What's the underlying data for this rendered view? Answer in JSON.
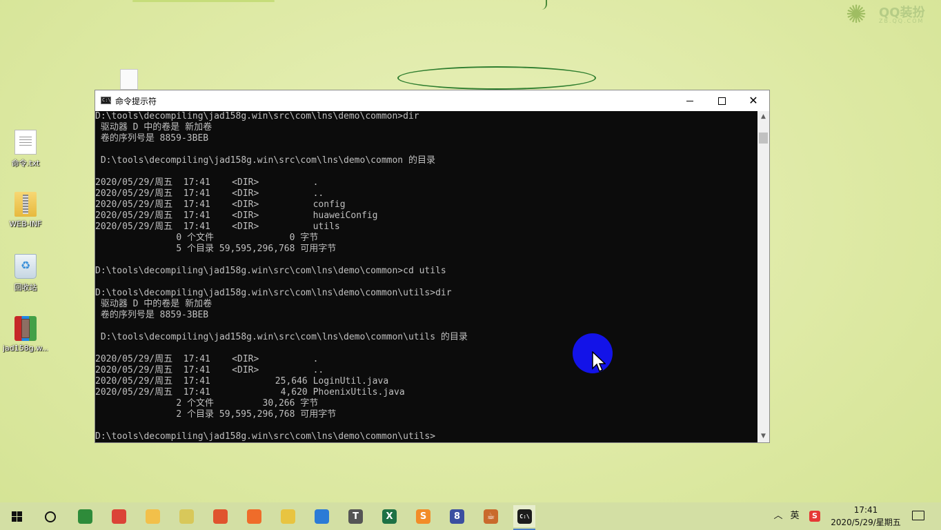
{
  "desktop": {
    "watermark": {
      "title": "QQ装扮",
      "subtitle": "ZB.QQ.COM"
    },
    "icons": [
      {
        "label": "命令.txt",
        "icon": "text-file-icon"
      },
      {
        "label": "WEB-INF",
        "icon": "folder-icon"
      },
      {
        "label": "回收站",
        "icon": "recycle-bin-icon"
      },
      {
        "label": "jad158g.w...",
        "icon": "winrar-archive-icon"
      }
    ]
  },
  "window": {
    "title": "命令提示符",
    "buttons": {
      "minimize": "minimize-icon",
      "maximize": "maximize-icon",
      "close": "✕"
    }
  },
  "console": {
    "lines": [
      "D:\\tools\\decompiling\\jad158g.win\\src\\com\\lns\\demo\\common>dir",
      " 驱动器 D 中的卷是 新加卷",
      " 卷的序列号是 8859-3BEB",
      "",
      " D:\\tools\\decompiling\\jad158g.win\\src\\com\\lns\\demo\\common 的目录",
      "",
      "2020/05/29/周五  17:41    <DIR>          .",
      "2020/05/29/周五  17:41    <DIR>          ..",
      "2020/05/29/周五  17:41    <DIR>          config",
      "2020/05/29/周五  17:41    <DIR>          huaweiConfig",
      "2020/05/29/周五  17:41    <DIR>          utils",
      "               0 个文件              0 字节",
      "               5 个目录 59,595,296,768 可用字节",
      "",
      "D:\\tools\\decompiling\\jad158g.win\\src\\com\\lns\\demo\\common>cd utils",
      "",
      "D:\\tools\\decompiling\\jad158g.win\\src\\com\\lns\\demo\\common\\utils>dir",
      " 驱动器 D 中的卷是 新加卷",
      " 卷的序列号是 8859-3BEB",
      "",
      " D:\\tools\\decompiling\\jad158g.win\\src\\com\\lns\\demo\\common\\utils 的目录",
      "",
      "2020/05/29/周五  17:41    <DIR>          .",
      "2020/05/29/周五  17:41    <DIR>          ..",
      "2020/05/29/周五  17:41            25,646 LoginUtil.java",
      "2020/05/29/周五  17:41             4,620 PhoenixUtils.java",
      "               2 个文件         30,266 字节",
      "               2 个目录 59,595,296,768 可用字节",
      "",
      "D:\\tools\\decompiling\\jad158g.win\\src\\com\\lns\\demo\\common\\utils>"
    ]
  },
  "taskbar": {
    "apps": [
      {
        "name": "sourcetree-icon",
        "glyph": "",
        "color": "#2e8b3a"
      },
      {
        "name": "chrome-icon",
        "glyph": "",
        "color": "#db4437"
      },
      {
        "name": "file-explorer-icon",
        "glyph": "",
        "color": "#f2c04a"
      },
      {
        "name": "notepad-icon",
        "glyph": "",
        "color": "#d8c85a"
      },
      {
        "name": "snail-app-icon",
        "glyph": "",
        "color": "#e0542e"
      },
      {
        "name": "postman-icon",
        "glyph": "",
        "color": "#ef6c2a"
      },
      {
        "name": "navicat-icon",
        "glyph": "",
        "color": "#e8c440"
      },
      {
        "name": "edge-icon",
        "glyph": "",
        "color": "#2b7bd6"
      },
      {
        "name": "typora-icon",
        "glyph": "T",
        "color": "#555555"
      },
      {
        "name": "excel-icon",
        "glyph": "X",
        "color": "#1e7145"
      },
      {
        "name": "sublime-icon",
        "glyph": "S",
        "color": "#f28c28"
      },
      {
        "name": "eclipse-icon",
        "glyph": "8",
        "color": "#3b4fa0"
      },
      {
        "name": "java-icon",
        "glyph": "☕",
        "color": "#c96a2c"
      },
      {
        "name": "cmd-icon",
        "glyph": "C:\\",
        "color": "#1c1c1c"
      }
    ],
    "tray": {
      "ime": "英",
      "sogou": "S",
      "time": "17:41",
      "date": "2020/5/29/星期五"
    }
  }
}
